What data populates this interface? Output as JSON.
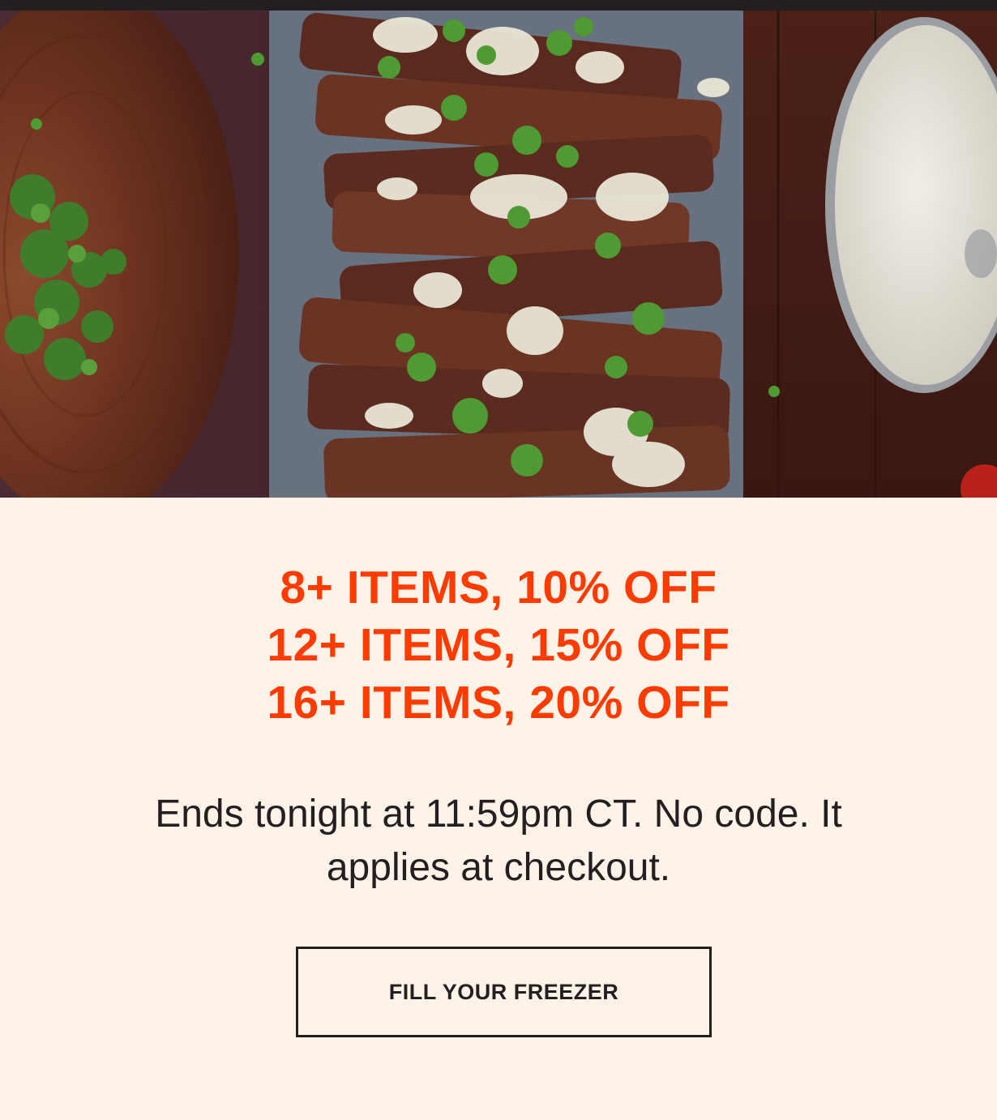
{
  "hero": {
    "image_icon": "grilled-ribs-photo"
  },
  "offers": [
    "8+ ITEMS, 10% OFF",
    "12+ ITEMS, 15% OFF",
    "16+ ITEMS, 20% OFF"
  ],
  "note": "Ends tonight at 11:59pm CT. No code. It applies at checkout.",
  "cta": {
    "label": "FILL YOUR FREEZER"
  },
  "colors": {
    "background": "#fdf3e8",
    "accent": "#ff3b00",
    "text": "#231f20"
  }
}
